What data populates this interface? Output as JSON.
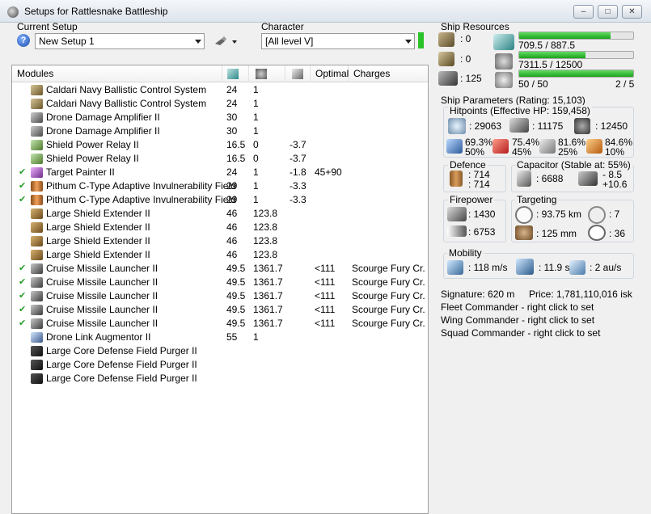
{
  "window": {
    "title": "Setups for Rattlesnake Battleship"
  },
  "setup": {
    "current_label": "Current Setup",
    "current_value": "New Setup 1",
    "character_label": "Character",
    "character_value": "[All level V]"
  },
  "modules": {
    "headers": {
      "name": "Modules",
      "optimal": "Optimal",
      "charges": "Charges"
    },
    "rows": [
      {
        "fitted": false,
        "icon": "ballistic-control-icon",
        "name": "Caldari Navy Ballistic Control System",
        "pg": "24",
        "cpu": "1",
        "cap": "",
        "optimal": "",
        "charge": ""
      },
      {
        "fitted": false,
        "icon": "ballistic-control-icon",
        "name": "Caldari Navy Ballistic Control System",
        "pg": "24",
        "cpu": "1",
        "cap": "",
        "optimal": "",
        "charge": ""
      },
      {
        "fitted": false,
        "icon": "drone-damage-icon",
        "name": "Drone Damage Amplifier II",
        "pg": "30",
        "cpu": "1",
        "cap": "",
        "optimal": "",
        "charge": ""
      },
      {
        "fitted": false,
        "icon": "drone-damage-icon",
        "name": "Drone Damage Amplifier II",
        "pg": "30",
        "cpu": "1",
        "cap": "",
        "optimal": "",
        "charge": ""
      },
      {
        "fitted": false,
        "icon": "shield-relay-icon",
        "name": "Shield Power Relay II",
        "pg": "16.5",
        "cpu": "0",
        "cap": "-3.7",
        "optimal": "",
        "charge": ""
      },
      {
        "fitted": false,
        "icon": "shield-relay-icon",
        "name": "Shield Power Relay II",
        "pg": "16.5",
        "cpu": "0",
        "cap": "-3.7",
        "optimal": "",
        "charge": ""
      },
      {
        "fitted": true,
        "icon": "target-painter-icon",
        "name": "Target Painter II",
        "pg": "24",
        "cpu": "1",
        "cap": "-1.8",
        "optimal": "45+90",
        "charge": ""
      },
      {
        "fitted": true,
        "icon": "invulnerability-field-icon",
        "name": "Pithum C-Type Adaptive Invulnerability Field",
        "pg": "29",
        "cpu": "1",
        "cap": "-3.3",
        "optimal": "",
        "charge": ""
      },
      {
        "fitted": true,
        "icon": "invulnerability-field-icon",
        "name": "Pithum C-Type Adaptive Invulnerability Field",
        "pg": "29",
        "cpu": "1",
        "cap": "-3.3",
        "optimal": "",
        "charge": ""
      },
      {
        "fitted": false,
        "icon": "shield-extender-icon",
        "name": "Large Shield Extender II",
        "pg": "46",
        "cpu": "123.8",
        "cap": "",
        "optimal": "",
        "charge": ""
      },
      {
        "fitted": false,
        "icon": "shield-extender-icon",
        "name": "Large Shield Extender II",
        "pg": "46",
        "cpu": "123.8",
        "cap": "",
        "optimal": "",
        "charge": ""
      },
      {
        "fitted": false,
        "icon": "shield-extender-icon",
        "name": "Large Shield Extender II",
        "pg": "46",
        "cpu": "123.8",
        "cap": "",
        "optimal": "",
        "charge": ""
      },
      {
        "fitted": false,
        "icon": "shield-extender-icon",
        "name": "Large Shield Extender II",
        "pg": "46",
        "cpu": "123.8",
        "cap": "",
        "optimal": "",
        "charge": ""
      },
      {
        "fitted": true,
        "icon": "missile-launcher-icon",
        "name": "Cruise Missile Launcher II",
        "pg": "49.5",
        "cpu": "1361.7",
        "cap": "",
        "optimal": "<111",
        "charge": "Scourge Fury Cr..."
      },
      {
        "fitted": true,
        "icon": "missile-launcher-icon",
        "name": "Cruise Missile Launcher II",
        "pg": "49.5",
        "cpu": "1361.7",
        "cap": "",
        "optimal": "<111",
        "charge": "Scourge Fury Cr..."
      },
      {
        "fitted": true,
        "icon": "missile-launcher-icon",
        "name": "Cruise Missile Launcher II",
        "pg": "49.5",
        "cpu": "1361.7",
        "cap": "",
        "optimal": "<111",
        "charge": "Scourge Fury Cr..."
      },
      {
        "fitted": true,
        "icon": "missile-launcher-icon",
        "name": "Cruise Missile Launcher II",
        "pg": "49.5",
        "cpu": "1361.7",
        "cap": "",
        "optimal": "<111",
        "charge": "Scourge Fury Cr..."
      },
      {
        "fitted": true,
        "icon": "missile-launcher-icon",
        "name": "Cruise Missile Launcher II",
        "pg": "49.5",
        "cpu": "1361.7",
        "cap": "",
        "optimal": "<111",
        "charge": "Scourge Fury Cr..."
      },
      {
        "fitted": false,
        "icon": "drone-link-icon",
        "name": "Drone Link Augmentor II",
        "pg": "55",
        "cpu": "1",
        "cap": "",
        "optimal": "",
        "charge": ""
      },
      {
        "fitted": false,
        "icon": "rig-icon",
        "name": "Large Core Defense Field Purger II",
        "pg": "",
        "cpu": "",
        "cap": "",
        "optimal": "",
        "charge": ""
      },
      {
        "fitted": false,
        "icon": "rig-icon",
        "name": "Large Core Defense Field Purger II",
        "pg": "",
        "cpu": "",
        "cap": "",
        "optimal": "",
        "charge": ""
      },
      {
        "fitted": false,
        "icon": "rig-icon",
        "name": "Large Core Defense Field Purger II",
        "pg": "",
        "cpu": "",
        "cap": "",
        "optimal": "",
        "charge": ""
      }
    ]
  },
  "resources": {
    "title": "Ship Resources",
    "turret_slots": ": 0",
    "launcher_slots": ": 0",
    "calibration": ": 125",
    "powergrid": "709.5 / 887.5",
    "powergrid_fraction": 0.799,
    "cpu": "7311.5 / 12500",
    "cpu_fraction": 0.585,
    "drone_bay": "50 / 50",
    "drone_bay_fraction": 1.0,
    "drones_active": "2 / 5"
  },
  "params": {
    "title": "Ship Parameters (Rating: 15,103)",
    "hitpoints": {
      "title": "Hitpoints (Effective HP: 159,458)",
      "shield": ": 29063",
      "armor": ": 11175",
      "structure": ": 12450",
      "em": [
        "69.3%",
        "50%"
      ],
      "thermal": [
        "75.4%",
        "45%"
      ],
      "kinetic": [
        "81.6%",
        "25%"
      ],
      "explosive": [
        "84.6%",
        "10%"
      ]
    },
    "defence": {
      "title": "Defence",
      "values": [
        ": 714",
        ": 714"
      ]
    },
    "capacitor": {
      "title": "Capacitor (Stable at: 55%)",
      "amount": ": 6688",
      "delta": [
        "- 8.5",
        "+10.6"
      ]
    },
    "firepower": {
      "title": "Firepower",
      "dps": ": 1430",
      "volley": ": 6753"
    },
    "targeting": {
      "title": "Targeting",
      "range": ": 93.75 km",
      "max_targets": ": 7",
      "resolution": ": 125 mm",
      "sensor": ": 36"
    },
    "mobility": {
      "title": "Mobility",
      "speed": ": 118 m/s",
      "align": ": 11.9 s",
      "warp": ": 2 au/s"
    }
  },
  "summary": {
    "signature": "Signature: 620 m",
    "price": "Price: 1,781,110,016 isk",
    "fleet": "Fleet Commander - right click to set",
    "wing": "Wing Commander - right click to set",
    "squad": "Squad Commander - right click to set"
  },
  "colors": {
    "bar_green": "#2ac32a",
    "check_green": "#2a9d2a"
  }
}
